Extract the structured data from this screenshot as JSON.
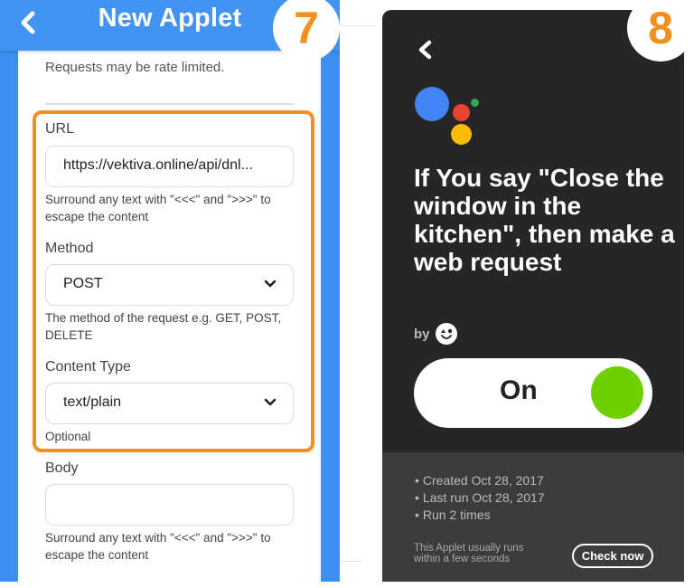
{
  "left_panel": {
    "step_number": "7",
    "header": {
      "title": "New Applet",
      "back_icon": "chevron-left-icon"
    },
    "rate_limit_text": "Requests may be rate limited.",
    "fields": {
      "url": {
        "label": "URL",
        "value": "https://vektiva.online/api/dnl...",
        "helper": "Surround any text with \"<<<\" and \">>>\" to escape the content"
      },
      "method": {
        "label": "Method",
        "value": "POST",
        "helper": "The method of the request e.g. GET, POST, DELETE"
      },
      "content_type": {
        "label": "Content Type",
        "value": "text/plain",
        "helper": "Optional"
      },
      "body": {
        "label": "Body",
        "value": "",
        "helper": "Surround any text with \"<<<\" and \">>>\" to escape the content"
      }
    },
    "colors": {
      "header": "#4293f2",
      "highlight": "#f3901d"
    }
  },
  "right_panel": {
    "step_number": "8",
    "back_icon": "chevron-left-icon",
    "service_logo": "google-assistant-icon",
    "title": "If You say \"Close the window in the kitchen\", then make a web request",
    "by_label": "by",
    "toggle": {
      "label": "On",
      "state": true,
      "color": "#6fd000"
    },
    "stats": [
      "Created Oct 28, 2017",
      "Last run Oct 28, 2017",
      "Run 2 times"
    ],
    "runs_note": "This Applet usually runs within a few seconds",
    "check_button": "Check now"
  }
}
